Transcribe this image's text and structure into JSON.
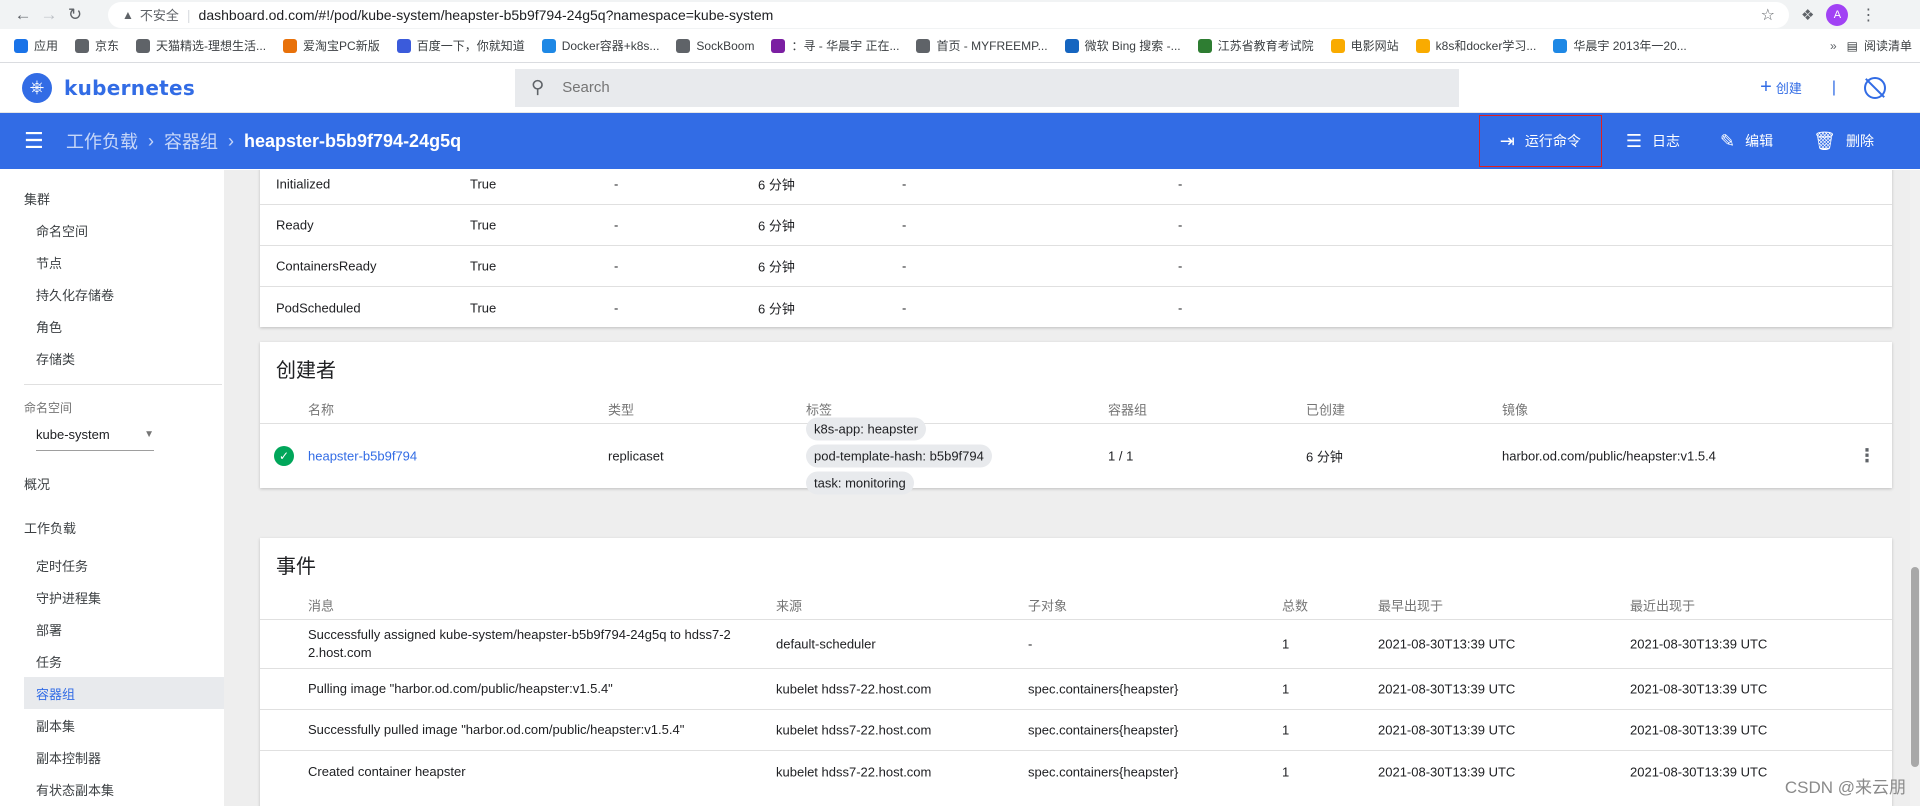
{
  "browser": {
    "not_secure": "不安全",
    "url": "dashboard.od.com/#!/pod/kube-system/heapster-b5b9f794-24g5q?namespace=kube-system",
    "bookmarks": [
      {
        "label": "应用",
        "color": "#1a73e8"
      },
      {
        "label": "京东",
        "color": "#5f6368"
      },
      {
        "label": "天猫精选-理想生活...",
        "color": "#5f6368"
      },
      {
        "label": "爱淘宝PC新版",
        "color": "#e8710a"
      },
      {
        "label": "百度一下，你就知道",
        "color": "#3b5bdb"
      },
      {
        "label": "Docker容器+k8s...",
        "color": "#1e88e5"
      },
      {
        "label": "SockBoom",
        "color": "#5f6368"
      },
      {
        "label": "：寻 - 华晨宇 正在...",
        "color": "#7b1fa2"
      },
      {
        "label": "首页 - MYFREEMP...",
        "color": "#5f6368"
      },
      {
        "label": "微软 Bing 搜索 -...",
        "color": "#1565c0"
      },
      {
        "label": "江苏省教育考试院",
        "color": "#2e7d32"
      },
      {
        "label": "电影网站",
        "color": "#f9ab00"
      },
      {
        "label": "k8s和docker学习...",
        "color": "#f9ab00"
      },
      {
        "label": "华晨宇 2013年一20...",
        "color": "#1e88e5"
      }
    ],
    "more": "»",
    "reading_list": "阅读清单",
    "avatar_letter": "A"
  },
  "app": {
    "logo": "kubernetes",
    "search_placeholder": "Search",
    "create": "创建"
  },
  "breadcrumb": {
    "workloads": "工作负载",
    "pods": "容器组",
    "current": "heapster-b5b9f794-24g5q"
  },
  "actions": {
    "exec": "运行命令",
    "logs": "日志",
    "edit": "编辑",
    "delete": "删除"
  },
  "sidebar": {
    "cluster": "集群",
    "cluster_items": [
      "命名空间",
      "节点",
      "持久化存储卷",
      "角色",
      "存储类"
    ],
    "namespace_label": "命名空间",
    "namespace_value": "kube-system",
    "overview": "概况",
    "workloads": "工作负载",
    "workload_items": [
      "定时任务",
      "守护进程集",
      "部署",
      "任务",
      "容器组",
      "副本集",
      "副本控制器",
      "有状态副本集"
    ],
    "active_index": 4
  },
  "conditions": [
    {
      "type": "Initialized",
      "status": "True",
      "last_probe": "-",
      "last_transition": "6 分钟",
      "reason": "-",
      "message": "-"
    },
    {
      "type": "Ready",
      "status": "True",
      "last_probe": "-",
      "last_transition": "6 分钟",
      "reason": "-",
      "message": "-"
    },
    {
      "type": "ContainersReady",
      "status": "True",
      "last_probe": "-",
      "last_transition": "6 分钟",
      "reason": "-",
      "message": "-"
    },
    {
      "type": "PodScheduled",
      "status": "True",
      "last_probe": "-",
      "last_transition": "6 分钟",
      "reason": "-",
      "message": "-"
    }
  ],
  "creator": {
    "title": "创建者",
    "headers": [
      "名称",
      "类型",
      "标签",
      "容器组",
      "已创建",
      "镜像"
    ],
    "row": {
      "name": "heapster-b5b9f794",
      "type": "replicaset",
      "labels": [
        "k8s-app: heapster",
        "pod-template-hash: b5b9f794",
        "task: monitoring"
      ],
      "pods": "1 / 1",
      "created": "6 分钟",
      "image": "harbor.od.com/public/heapster:v1.5.4"
    }
  },
  "events": {
    "title": "事件",
    "headers": [
      "消息",
      "来源",
      "子对象",
      "总数",
      "最早出现于",
      "最近出现于"
    ],
    "rows": [
      {
        "message_line1": "Successfully assigned kube-system/heapster-b5b9f794-24g5q to hdss7-2",
        "message_line2": "2.host.com",
        "source": "default-scheduler",
        "object": "-",
        "count": "1",
        "first": "2021-08-30T13:39 UTC",
        "last": "2021-08-30T13:39 UTC"
      },
      {
        "message_line1": "Pulling image \"harbor.od.com/public/heapster:v1.5.4\"",
        "message_line2": "",
        "source": "kubelet hdss7-22.host.com",
        "object": "spec.containers{heapster}",
        "count": "1",
        "first": "2021-08-30T13:39 UTC",
        "last": "2021-08-30T13:39 UTC"
      },
      {
        "message_line1": "Successfully pulled image \"harbor.od.com/public/heapster:v1.5.4\"",
        "message_line2": "",
        "source": "kubelet hdss7-22.host.com",
        "object": "spec.containers{heapster}",
        "count": "1",
        "first": "2021-08-30T13:39 UTC",
        "last": "2021-08-30T13:39 UTC"
      },
      {
        "message_line1": "Created container heapster",
        "message_line2": "",
        "source": "kubelet hdss7-22.host.com",
        "object": "spec.containers{heapster}",
        "count": "1",
        "first": "2021-08-30T13:39 UTC",
        "last": "2021-08-30T13:39 UTC"
      }
    ]
  },
  "watermark": "CSDN @来云朋"
}
